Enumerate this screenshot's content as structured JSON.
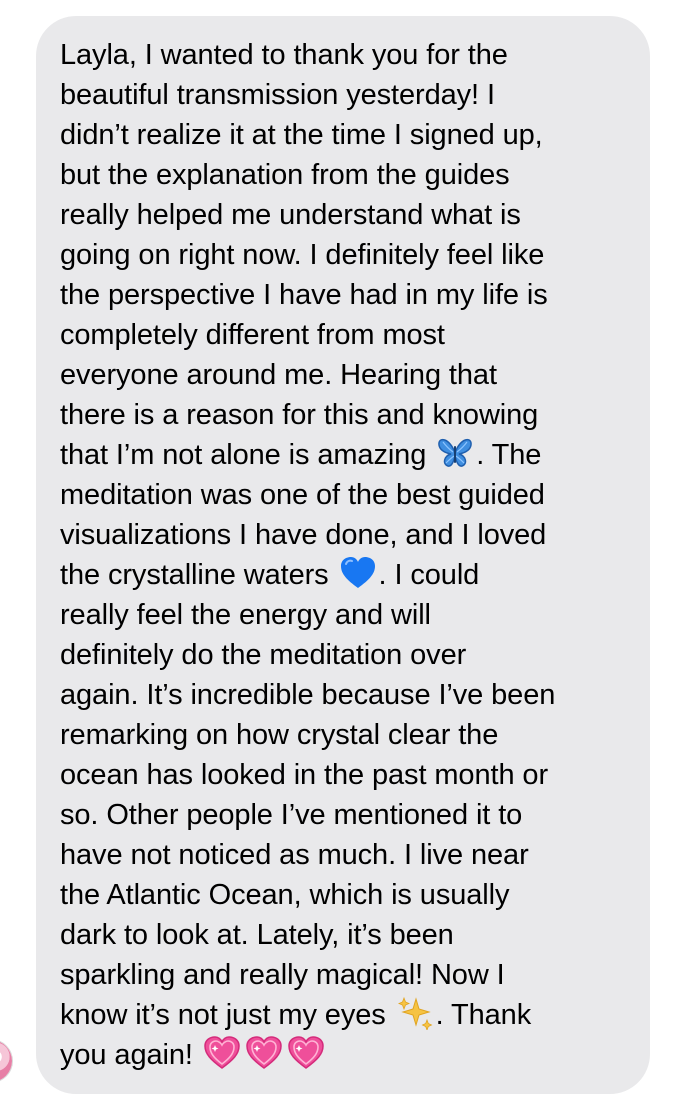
{
  "message": {
    "lines": [
      "Layla, I wanted to thank you for the",
      "beautiful transmission yesterday! I",
      "didn’t realize it at the time I signed up,",
      "but the explanation from the guides",
      "really helped me understand what is",
      "going on right now. I definitely feel like",
      "the perspective I have had in my life is",
      "completely different from most",
      "everyone around me. Hearing that",
      "there is a reason for this and knowing",
      "that I’m not alone is amazing ",
      ". The",
      "meditation was one of the best guided",
      "visualizations I have done, and I loved",
      "the crystalline waters ",
      ". I could",
      "really feel the energy and will",
      "definitely do the meditation over",
      "again. It’s incredible because I’ve been",
      "remarking on how crystal clear the",
      "ocean has looked in the past month or",
      "so. Other people I’ve mentioned it to",
      "have not noticed as much. I live near",
      "the Atlantic Ocean, which is usually",
      "dark to look at. Lately, it’s been",
      "sparkling and really magical! Now I",
      "know it’s not just my eyes ",
      ". Thank",
      "you again! "
    ],
    "emojis": {
      "butterfly": "butterfly-icon",
      "blue_heart": "blue-heart-icon",
      "sparkles": "sparkles-icon",
      "sparkling_heart": "sparkling-heart-icon"
    },
    "colors": {
      "bubble": "#e9e9eb",
      "text": "#000000"
    }
  }
}
